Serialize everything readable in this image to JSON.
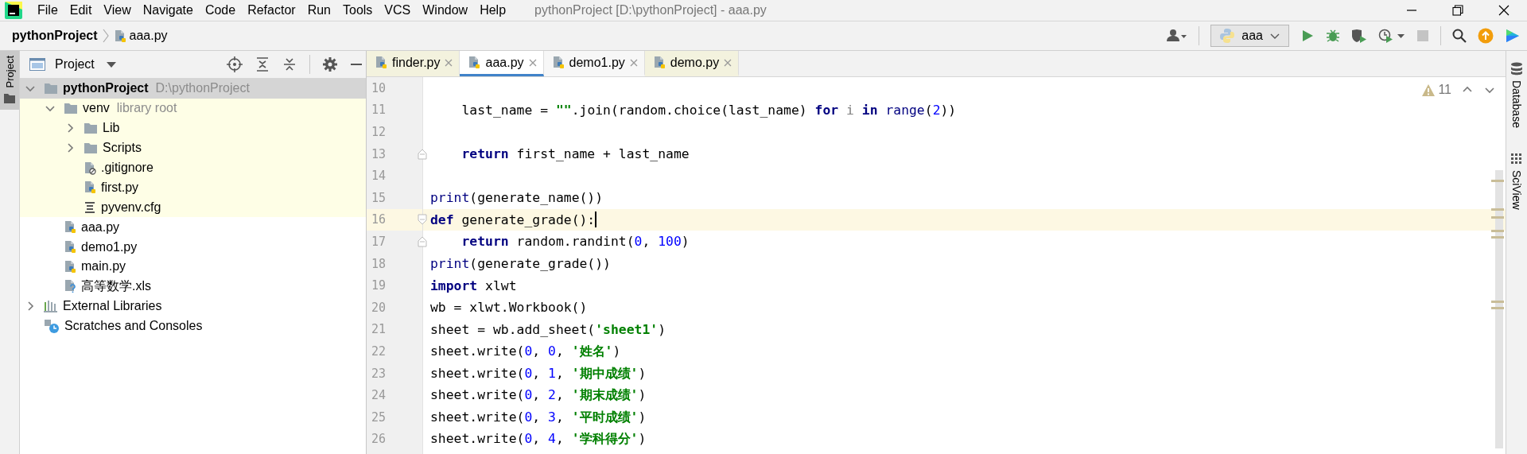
{
  "window": {
    "title": "pythonProject [D:\\pythonProject] - aaa.py"
  },
  "menu": [
    "File",
    "Edit",
    "View",
    "Navigate",
    "Code",
    "Refactor",
    "Run",
    "Tools",
    "VCS",
    "Window",
    "Help"
  ],
  "breadcrumbs": [
    "pythonProject",
    "aaa.py"
  ],
  "run_config": {
    "label": "aaa"
  },
  "left_tool_window": {
    "label": "Project",
    "selected": true
  },
  "project_panel": {
    "title": "Project",
    "tree": [
      {
        "label": "pythonProject",
        "hint": "D:\\pythonProject",
        "kind": "folder",
        "expanded": true,
        "selected": true,
        "children": [
          {
            "label": "venv",
            "hint": "library root",
            "kind": "folder",
            "expanded": true,
            "selected": false,
            "library": true,
            "children": [
              {
                "label": "Lib",
                "kind": "folder",
                "expanded": false,
                "selected": false
              },
              {
                "label": "Scripts",
                "kind": "folder",
                "expanded": false,
                "selected": false
              },
              {
                "label": ".gitignore",
                "kind": "ignored",
                "selected": false
              },
              {
                "label": "first.py",
                "kind": "python",
                "selected": false
              },
              {
                "label": "pyvenv.cfg",
                "kind": "config",
                "selected": false
              }
            ]
          },
          {
            "label": "aaa.py",
            "kind": "python",
            "selected": false
          },
          {
            "label": "demo1.py",
            "kind": "python",
            "selected": false
          },
          {
            "label": "main.py",
            "kind": "python",
            "selected": false
          },
          {
            "label": "高等数学.xls",
            "kind": "unknown",
            "selected": false
          }
        ]
      },
      {
        "label": "External Libraries",
        "kind": "libraries",
        "expanded": false,
        "selected": false
      },
      {
        "label": "Scratches and Consoles",
        "kind": "scratches",
        "selected": false
      }
    ]
  },
  "tabs": [
    {
      "label": "finder.py",
      "selected": false,
      "color": "#f3f2de"
    },
    {
      "label": "aaa.py",
      "selected": true,
      "color": "#ffffff"
    },
    {
      "label": "demo1.py",
      "selected": false,
      "color": "#f7f7f7"
    },
    {
      "label": "demo.py",
      "selected": false,
      "color": "#f3f2de"
    }
  ],
  "editor": {
    "warnings": "11",
    "lines": [
      {
        "number": "10",
        "current": false
      },
      {
        "number": "11",
        "current": false,
        "tokens": [
          {
            "kind": "text",
            "text": "    last_name = "
          },
          {
            "kind": "string",
            "text": "\"\""
          },
          {
            "kind": "text",
            "text": ".join(random.choice(last_name) "
          },
          {
            "kind": "keyword",
            "text": "for"
          },
          {
            "kind": "unused",
            "text": " i "
          },
          {
            "kind": "keyword",
            "text": "in"
          },
          {
            "kind": "builtin",
            "text": " range"
          },
          {
            "kind": "text",
            "text": "("
          },
          {
            "kind": "number",
            "text": "2"
          },
          {
            "kind": "text",
            "text": "))"
          }
        ]
      },
      {
        "number": "12",
        "current": false
      },
      {
        "number": "13",
        "current": false,
        "fold_close": true,
        "tokens": [
          {
            "kind": "keyword",
            "text": "    return"
          },
          {
            "kind": "text",
            "text": " first_name + last_name"
          }
        ]
      },
      {
        "number": "14",
        "current": false
      },
      {
        "number": "15",
        "current": false,
        "tokens": [
          {
            "kind": "builtin",
            "text": "print"
          },
          {
            "kind": "text",
            "text": "(generate_name())"
          }
        ]
      },
      {
        "number": "16",
        "current": true,
        "fold_open": true,
        "tokens": [
          {
            "kind": "keyword",
            "text": "def"
          },
          {
            "kind": "text",
            "text": " generate_grade():"
          }
        ]
      },
      {
        "number": "17",
        "current": false,
        "fold_close": true,
        "tokens": [
          {
            "kind": "keyword",
            "text": "    return"
          },
          {
            "kind": "text",
            "text": " random.randint("
          },
          {
            "kind": "number",
            "text": "0"
          },
          {
            "kind": "text",
            "text": ", "
          },
          {
            "kind": "number",
            "text": "100"
          },
          {
            "kind": "text",
            "text": ")"
          }
        ]
      },
      {
        "number": "18",
        "current": false,
        "tokens": [
          {
            "kind": "builtin",
            "text": "print"
          },
          {
            "kind": "text",
            "text": "(generate_grade())"
          }
        ]
      },
      {
        "number": "19",
        "current": false,
        "tokens": [
          {
            "kind": "keyword",
            "text": "import"
          },
          {
            "kind": "text",
            "text": " xlwt"
          }
        ]
      },
      {
        "number": "20",
        "current": false,
        "tokens": [
          {
            "kind": "text",
            "text": "wb = xlwt.Workbook()"
          }
        ]
      },
      {
        "number": "21",
        "current": false,
        "tokens": [
          {
            "kind": "text",
            "text": "sheet = wb.add_sheet("
          },
          {
            "kind": "string",
            "text": "'sheet1'"
          },
          {
            "kind": "text",
            "text": ")"
          }
        ]
      },
      {
        "number": "22",
        "current": false,
        "tokens": [
          {
            "kind": "text",
            "text": "sheet.write("
          },
          {
            "kind": "number",
            "text": "0"
          },
          {
            "kind": "text",
            "text": ", "
          },
          {
            "kind": "number",
            "text": "0"
          },
          {
            "kind": "text",
            "text": ", "
          },
          {
            "kind": "string",
            "text": "'姓名'"
          },
          {
            "kind": "text",
            "text": ")"
          }
        ]
      },
      {
        "number": "23",
        "current": false,
        "tokens": [
          {
            "kind": "text",
            "text": "sheet.write("
          },
          {
            "kind": "number",
            "text": "0"
          },
          {
            "kind": "text",
            "text": ", "
          },
          {
            "kind": "number",
            "text": "1"
          },
          {
            "kind": "text",
            "text": ", "
          },
          {
            "kind": "string",
            "text": "'期中成绩'"
          },
          {
            "kind": "text",
            "text": ")"
          }
        ]
      },
      {
        "number": "24",
        "current": false,
        "tokens": [
          {
            "kind": "text",
            "text": "sheet.write("
          },
          {
            "kind": "number",
            "text": "0"
          },
          {
            "kind": "text",
            "text": ", "
          },
          {
            "kind": "number",
            "text": "2"
          },
          {
            "kind": "text",
            "text": ", "
          },
          {
            "kind": "string",
            "text": "'期末成绩'"
          },
          {
            "kind": "text",
            "text": ")"
          }
        ]
      },
      {
        "number": "25",
        "current": false,
        "tokens": [
          {
            "kind": "text",
            "text": "sheet.write("
          },
          {
            "kind": "number",
            "text": "0"
          },
          {
            "kind": "text",
            "text": ", "
          },
          {
            "kind": "number",
            "text": "3"
          },
          {
            "kind": "text",
            "text": ", "
          },
          {
            "kind": "string",
            "text": "'平时成绩'"
          },
          {
            "kind": "text",
            "text": ")"
          }
        ]
      },
      {
        "number": "26",
        "current": false,
        "tokens": [
          {
            "kind": "text",
            "text": "sheet.write("
          },
          {
            "kind": "number",
            "text": "0"
          },
          {
            "kind": "text",
            "text": ", "
          },
          {
            "kind": "number",
            "text": "4"
          },
          {
            "kind": "text",
            "text": ", "
          },
          {
            "kind": "string",
            "text": "'学科得分'"
          },
          {
            "kind": "text",
            "text": ")"
          }
        ]
      }
    ]
  },
  "right_tool_windows": [
    {
      "label": "Database",
      "kind": "database"
    },
    {
      "label": "SciView",
      "kind": "sciview"
    }
  ]
}
